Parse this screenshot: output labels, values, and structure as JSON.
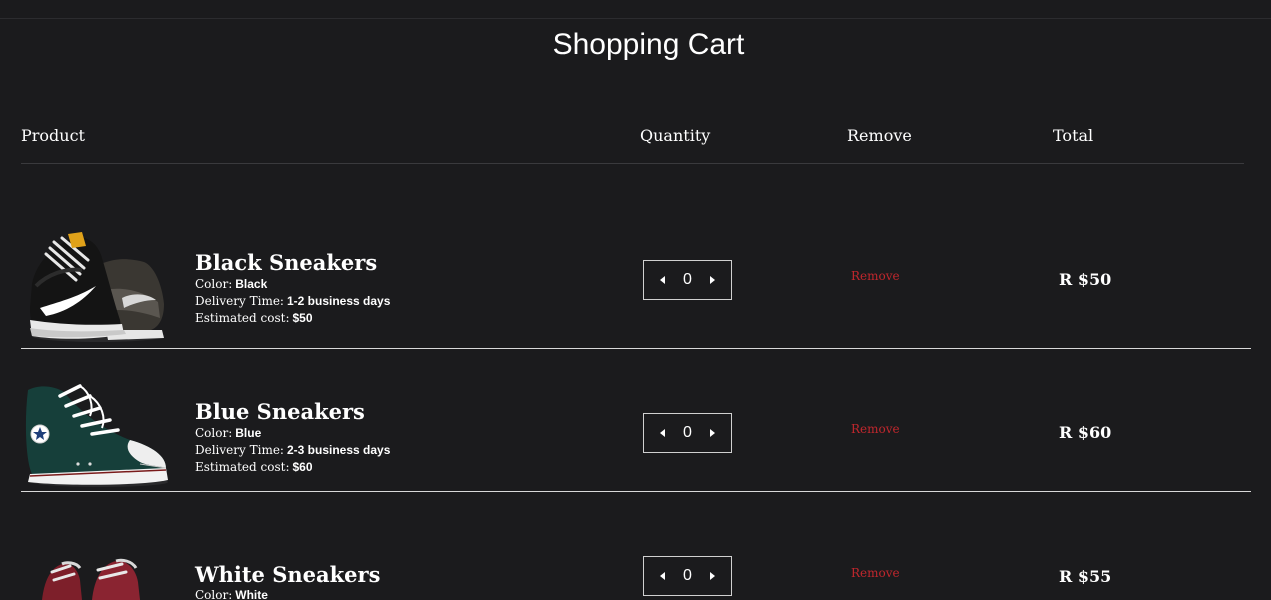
{
  "page": {
    "title": "Shopping Cart"
  },
  "table": {
    "headers": {
      "product": "Product",
      "quantity": "Quantity",
      "remove": "Remove",
      "total": "Total"
    },
    "labels": {
      "color": "Color:",
      "delivery": "Delivery Time:",
      "estimated": "Estimated cost:"
    },
    "items": [
      {
        "name": "Black Sneakers",
        "image": "black-sneakers-image",
        "color": "Black",
        "delivery": "1-2 business days",
        "estimated_cost": "$50",
        "quantity": "0",
        "remove_label": "Remove",
        "total": "R $50"
      },
      {
        "name": "Blue Sneakers",
        "image": "blue-sneakers-image",
        "color": "Blue",
        "delivery": "2-3 business days",
        "estimated_cost": "$60",
        "quantity": "0",
        "remove_label": "Remove",
        "total": "R $60"
      },
      {
        "name": "White Sneakers",
        "image": "white-sneakers-image",
        "color": "White",
        "quantity": "0",
        "remove_label": "Remove",
        "total": "R $55"
      }
    ]
  },
  "colors": {
    "background": "#1b1b1d",
    "text": "#ffffff",
    "remove_link": "#c0272d",
    "row_divider": "#d9d9d9"
  }
}
